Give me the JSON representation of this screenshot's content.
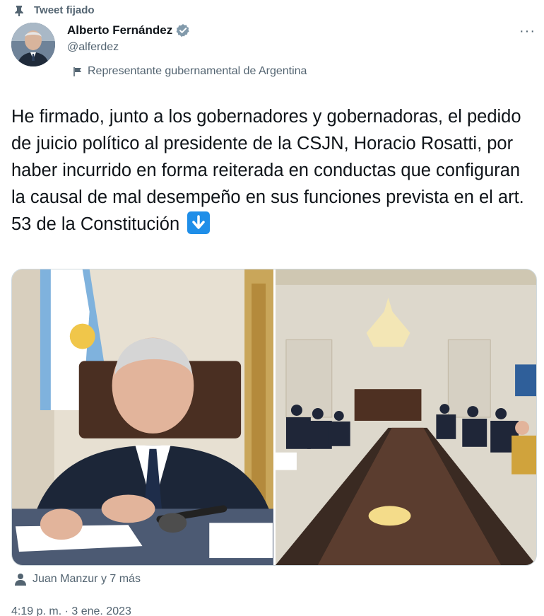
{
  "pinned": {
    "label": "Tweet fijado",
    "icon": "pin-icon"
  },
  "author": {
    "name": "Alberto Fernández",
    "handle": "@alferdez",
    "verified_icon": "verified-badge-icon",
    "avatar_alt": "avatar"
  },
  "more_icon": "more-options-icon",
  "label": {
    "icon": "flag-icon",
    "text": "Representante gubernamental de Argentina"
  },
  "tweet_text": "He firmado, junto a los gobernadores y gobernadoras, el pedido de juicio político al presidente de la CSJN, Horacio Rosatti, por haber incurrido en forma reiterada en conductas que configuran la causal de mal desempeño en sus funciones prevista en el art. 53 de la Constitución",
  "tweet_emoji_icon": "down-arrow-emoji-icon",
  "media": {
    "count": 2
  },
  "tagged": {
    "icon": "person-icon",
    "text": "Juan Manzur y 7 más"
  },
  "timestamp": "4:19 p. m. · 3 ene. 2023",
  "colors": {
    "text": "#0f1419",
    "secondary": "#536471",
    "verified": "#829aab",
    "emoji_blue": "#1f8ee8",
    "border": "#cfd9de"
  }
}
